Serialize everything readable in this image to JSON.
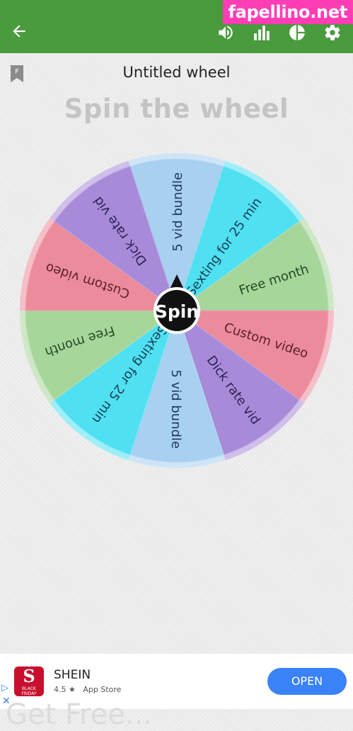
{
  "appbar": {
    "color": "#4a9a3e",
    "icons": [
      "arrow-left-icon",
      "volume-icon",
      "bar-chart-icon",
      "pie-chart-icon",
      "gear-icon"
    ]
  },
  "watermark": "fapellino.net",
  "favorite_badge": "F",
  "wheel_name": "Untitled wheel",
  "title": "Spin the wheel",
  "wheel": {
    "segments": [
      {
        "label": "5 vid bundle",
        "color": "#a8d0f0",
        "text_color": "#1c3a57"
      },
      {
        "label": "Sexting for 25 min",
        "color": "#4fe0f2",
        "text_color": "#1a3f52"
      },
      {
        "label": "Free month",
        "color": "#a6d69a",
        "text_color": "#244a24"
      },
      {
        "label": "Custom video",
        "color": "#ec8b9b",
        "text_color": "#5a1f2a"
      },
      {
        "label": "Dick rate vid",
        "color": "#a78ad8",
        "text_color": "#2c2254"
      },
      {
        "label": "5 vid bundle",
        "color": "#a8d0f0",
        "text_color": "#1c3a57"
      },
      {
        "label": "Sexting for 25 min",
        "color": "#4fe0f2",
        "text_color": "#1a3f52"
      },
      {
        "label": "Free month",
        "color": "#a6d69a",
        "text_color": "#244a24"
      },
      {
        "label": "Custom video",
        "color": "#ec8b9b",
        "text_color": "#5a1f2a"
      },
      {
        "label": "Dick rate vid",
        "color": "#a78ad8",
        "text_color": "#2c2254"
      }
    ],
    "spin_label": "Spin"
  },
  "ad": {
    "app_name": "SHEIN",
    "rating": "4.5 ★",
    "store": "App Store",
    "button": "OPEN",
    "logo_letter": "S",
    "logo_caption": "BLACK FRIDAY",
    "overflow_text": "Get Free...",
    "adchoices_glyph": "▷",
    "close_glyph": "✕"
  }
}
